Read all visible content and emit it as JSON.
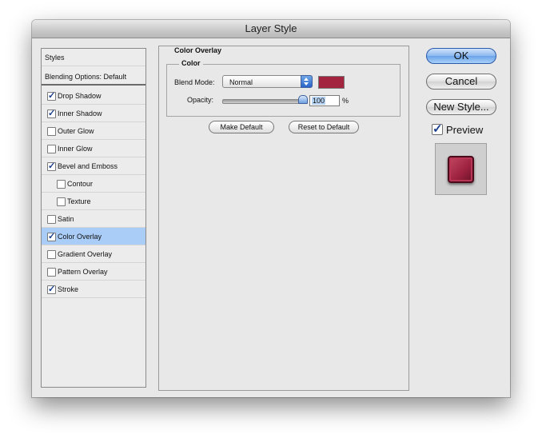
{
  "window": {
    "title": "Layer Style"
  },
  "styles_list": {
    "header": "Styles",
    "blending": "Blending Options: Default",
    "items": [
      {
        "label": "Drop Shadow",
        "checked": true
      },
      {
        "label": "Inner Shadow",
        "checked": true
      },
      {
        "label": "Outer Glow",
        "checked": false
      },
      {
        "label": "Inner Glow",
        "checked": false
      },
      {
        "label": "Bevel and Emboss",
        "checked": true
      },
      {
        "label": "Contour",
        "checked": false
      },
      {
        "label": "Texture",
        "checked": false
      },
      {
        "label": "Satin",
        "checked": false
      },
      {
        "label": "Color Overlay",
        "checked": true,
        "selected": true
      },
      {
        "label": "Gradient Overlay",
        "checked": false
      },
      {
        "label": "Pattern Overlay",
        "checked": false
      },
      {
        "label": "Stroke",
        "checked": true
      }
    ]
  },
  "color_overlay": {
    "section_title": "Color Overlay",
    "group_title": "Color",
    "blend_mode_label": "Blend Mode:",
    "blend_mode_value": "Normal",
    "color": "#a3243e",
    "opacity_label": "Opacity:",
    "opacity_value": "100",
    "opacity_unit": "%",
    "make_default": "Make Default",
    "reset_default": "Reset to Default"
  },
  "buttons": {
    "ok": "OK",
    "cancel": "Cancel",
    "new_style": "New Style...",
    "preview_label": "Preview",
    "preview_checked": true
  },
  "colors": {
    "selected_row": "#a9cdf7",
    "accent_blue": "#6aa3e8",
    "overlay_color": "#a3243e"
  }
}
